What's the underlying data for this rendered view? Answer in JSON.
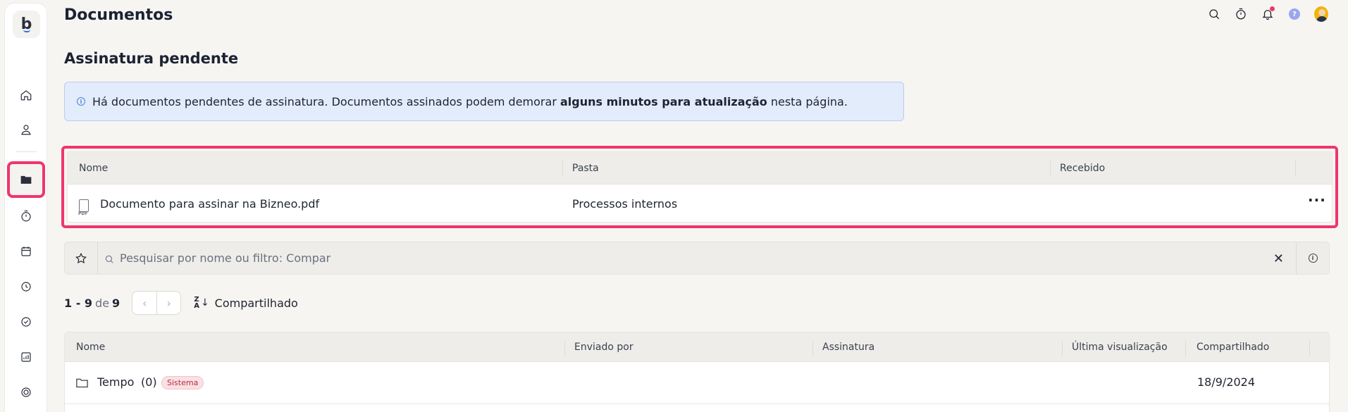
{
  "header": {
    "title": "Documentos"
  },
  "section": {
    "title": "Assinatura pendente"
  },
  "alert": {
    "text_before": "Há documentos pendentes de assinatura. Documentos assinados podem demorar ",
    "text_bold": "alguns minutos para atualização",
    "text_after": " nesta página."
  },
  "pending_table": {
    "columns": [
      "Nome",
      "Pasta",
      "Recebido"
    ],
    "rows": [
      {
        "name": "Documento para assinar na Bizneo.pdf",
        "folder": "Processos internos",
        "received": ""
      }
    ]
  },
  "search": {
    "placeholder": "Pesquisar por nome ou filtro: Compar"
  },
  "pager": {
    "from": "1 - 9",
    "of_label": "de",
    "total": "9",
    "sort_label": "Compartilhado"
  },
  "files_table": {
    "columns": [
      "Nome",
      "Enviado por",
      "Assinatura",
      "Última visualização",
      "Compartilhado"
    ],
    "rows": [
      {
        "name": "Tempo",
        "count": "(0)",
        "badge": "Sistema",
        "shared": "18/9/2024"
      }
    ]
  },
  "icons": {
    "sidebar": [
      "home-icon",
      "user-icon",
      "folder-icon",
      "timer-icon",
      "calendar-icon",
      "clock-check-icon",
      "check-circle-icon",
      "chart-icon",
      "target-icon"
    ],
    "topbar": [
      "search-icon",
      "timer-icon",
      "bell-icon",
      "help-icon",
      "avatar"
    ]
  },
  "colors": {
    "highlight": "#f0356d",
    "alert_bg": "#e2ecfb",
    "badge_bg": "#fbe1e4"
  }
}
